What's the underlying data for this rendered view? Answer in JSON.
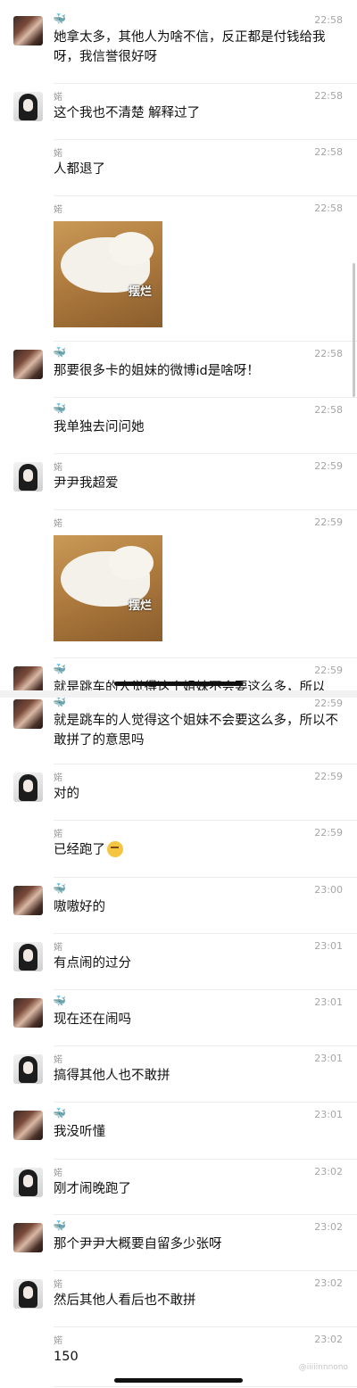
{
  "messages": [
    {
      "sender": "whale",
      "avatar": "girl1",
      "name": "",
      "time": "22:58",
      "text": "她拿太多，其他人为啥不信，反正都是付钱给我呀，我信誉很好呀"
    },
    {
      "sender": "婼",
      "avatar": "girl2",
      "name": "婼",
      "time": "22:58",
      "text": "这个我也不清楚 解释过了"
    },
    {
      "sender": "婼",
      "avatar": "",
      "name": "婼",
      "time": "22:58",
      "text": "人都退了"
    },
    {
      "sender": "婼",
      "avatar": "",
      "name": "婼",
      "time": "22:58",
      "sticker": "摆烂"
    },
    {
      "sender": "whale",
      "avatar": "girl1",
      "name": "",
      "time": "22:58",
      "text": "那要很多卡的姐妹的微博id是啥呀！"
    },
    {
      "sender": "whale",
      "avatar": "",
      "name": "",
      "time": "22:58",
      "text": "我单独去问问她"
    },
    {
      "sender": "婼",
      "avatar": "girl2",
      "name": "婼",
      "time": "22:59",
      "text": "尹尹我超爱"
    },
    {
      "sender": "婼",
      "avatar": "",
      "name": "婼",
      "time": "22:59",
      "sticker": "摆烂"
    },
    {
      "sender": "whale",
      "avatar": "girl1",
      "name": "",
      "time": "22:59",
      "text": "就是跳车的人觉得这个姐妹不会要这么多，所以"
    },
    {
      "sender": "whale",
      "avatar": "girl1",
      "name": "",
      "time": "22:59",
      "text": "就是跳车的人觉得这个姐妹不会要这么多，所以不敢拼了的意思吗"
    },
    {
      "sender": "婼",
      "avatar": "girl2",
      "name": "婼",
      "time": "22:59",
      "text": "对的"
    },
    {
      "sender": "婼",
      "avatar": "",
      "name": "婼",
      "time": "22:59",
      "text": "已经跑了"
    },
    {
      "sender": "whale",
      "avatar": "girl1",
      "name": "",
      "time": "23:00",
      "text": "嗷嗷好的"
    },
    {
      "sender": "婼",
      "avatar": "girl2",
      "name": "婼",
      "time": "23:01",
      "text": "有点闹的过分"
    },
    {
      "sender": "whale",
      "avatar": "girl1",
      "name": "",
      "time": "23:01",
      "text": "现在还在闹吗"
    },
    {
      "sender": "婼",
      "avatar": "girl2",
      "name": "婼",
      "time": "23:01",
      "text": "搞得其他人也不敢拼"
    },
    {
      "sender": "whale",
      "avatar": "girl1",
      "name": "",
      "time": "23:01",
      "text": "我没听懂"
    },
    {
      "sender": "婼",
      "avatar": "girl2",
      "name": "婼",
      "time": "23:02",
      "text": "刚才闹晚跑了"
    },
    {
      "sender": "whale",
      "avatar": "girl1",
      "name": "",
      "time": "23:02",
      "text": "那个尹尹大概要自留多少张呀"
    },
    {
      "sender": "婼",
      "avatar": "girl2",
      "name": "婼",
      "time": "23:02",
      "text": "然后其他人看后也不敢拼"
    },
    {
      "sender": "婼",
      "avatar": "",
      "name": "婼",
      "time": "23:02",
      "text": "150"
    }
  ],
  "icons": {
    "whale": "whale-icon",
    "emoji": "grimace-emoji-icon"
  },
  "watermark": "@iiiiinnnono",
  "colors": {
    "time": "#a6a6a6",
    "name": "#9a9a9a",
    "whale": "#3aa4d8"
  }
}
